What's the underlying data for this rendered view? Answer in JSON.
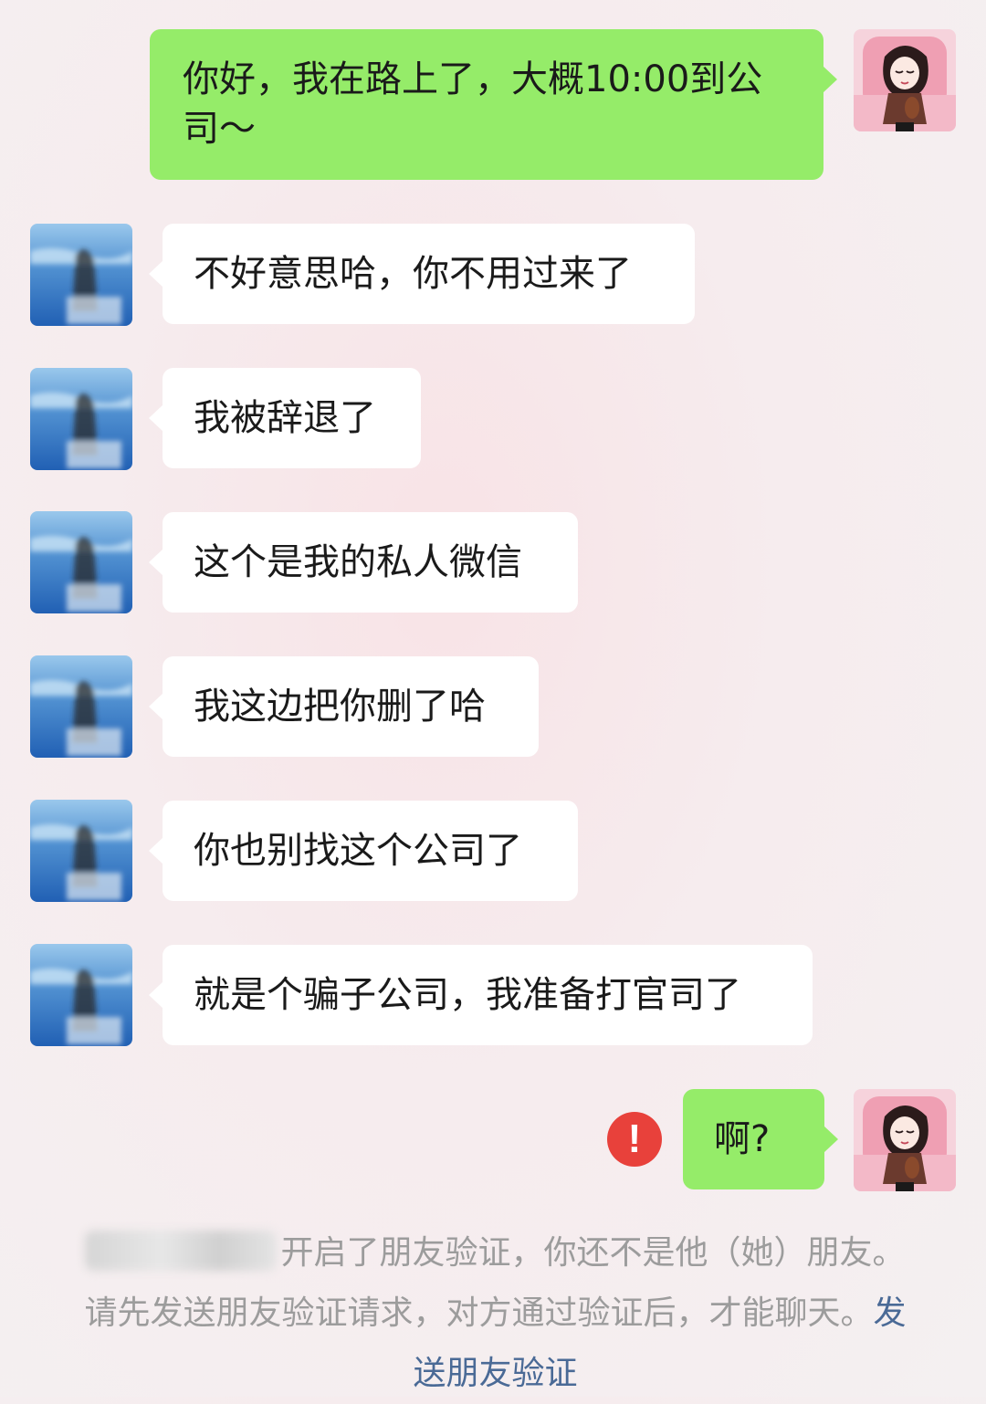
{
  "messages": [
    {
      "direction": "outgoing",
      "text": "你好，我在路上了，大概10:00到公司～"
    },
    {
      "direction": "incoming",
      "text": "不好意思哈，你不用过来了"
    },
    {
      "direction": "incoming",
      "text": "我被辞退了"
    },
    {
      "direction": "incoming",
      "text": "这个是我的私人微信"
    },
    {
      "direction": "incoming",
      "text": "我这边把你删了哈"
    },
    {
      "direction": "incoming",
      "text": "你也别找这个公司了"
    },
    {
      "direction": "incoming",
      "text": "就是个骗子公司，我准备打官司了"
    },
    {
      "direction": "outgoing",
      "text": "啊?",
      "send_failed": true
    }
  ],
  "error_icon": "!",
  "system_notice": {
    "text": "开启了朋友验证，你还不是他（她）朋友。请先发送朋友验证请求，对方通过验证后，才能聊天。",
    "link": "发送朋友验证"
  },
  "colors": {
    "outgoing_bubble": "#95ec69",
    "incoming_bubble": "#ffffff",
    "error": "#e8413b",
    "link": "#4a6a96"
  },
  "icons": {
    "self_avatar": "cartoon-girl-avatar",
    "contact_avatar": "blurred-landscape-avatar",
    "failed": "exclamation-circle-icon"
  }
}
